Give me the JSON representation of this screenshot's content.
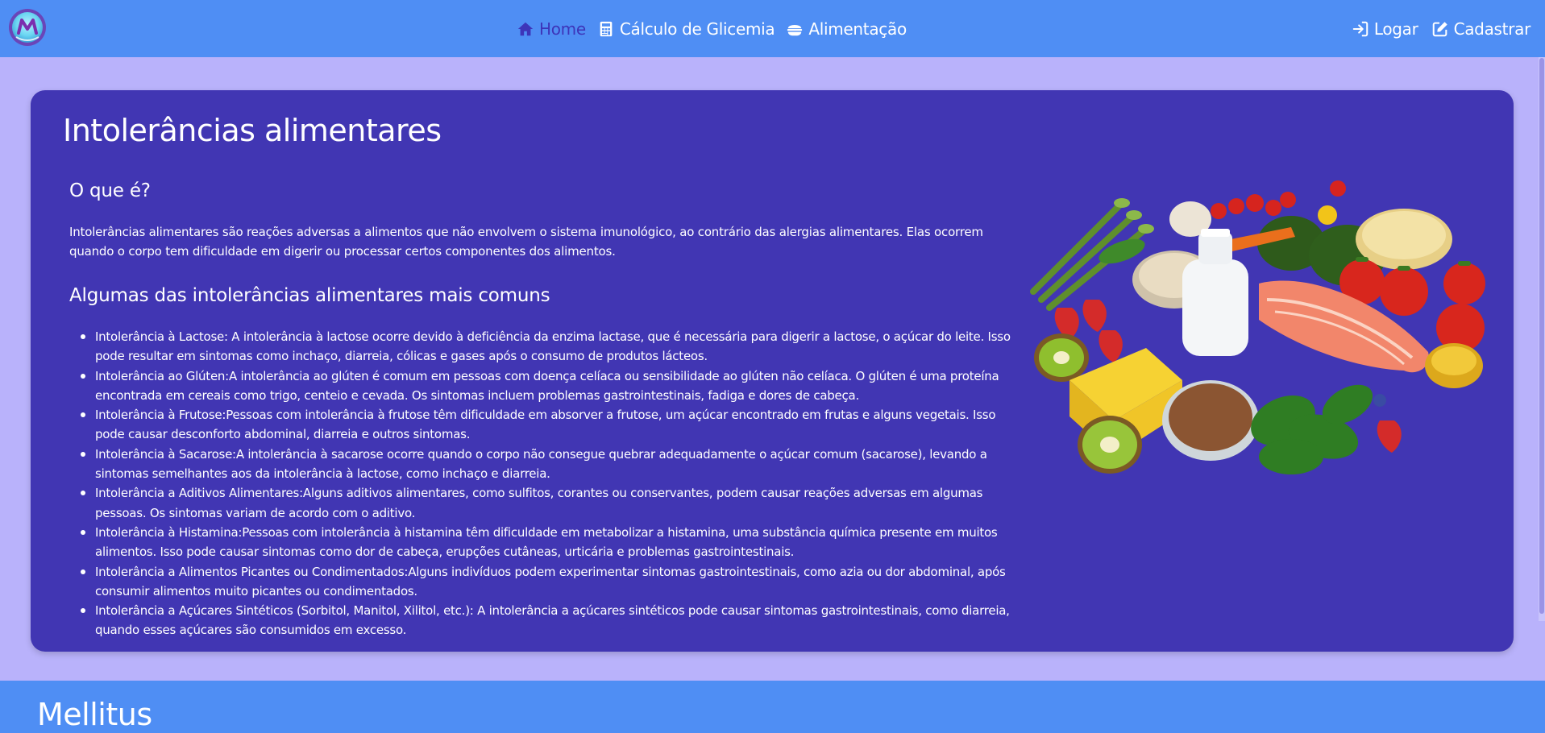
{
  "nav": {
    "logo_alt": "M",
    "links": [
      {
        "label": "Home",
        "icon": "home-icon",
        "active": true
      },
      {
        "label": "Cálculo de Glicemia",
        "icon": "calculator-icon",
        "active": false
      },
      {
        "label": "Alimentação",
        "icon": "food-bowl-icon",
        "active": false
      }
    ],
    "auth": [
      {
        "label": "Logar",
        "icon": "login-icon"
      },
      {
        "label": "Cadastrar",
        "icon": "edit-icon"
      }
    ]
  },
  "card": {
    "title": "Intolerâncias alimentares",
    "what_heading": "O que é?",
    "intro": "Intolerâncias alimentares são reações adversas a alimentos que não envolvem o sistema imunológico, ao contrário das alergias alimentares. Elas ocorrem quando o corpo tem dificuldade em digerir ou processar certos componentes dos alimentos.",
    "common_heading": "Algumas das intolerâncias alimentares mais comuns",
    "items": [
      "Intolerância à Lactose: A intolerância à lactose ocorre devido à deficiência da enzima lactase, que é necessária para digerir a lactose, o açúcar do leite. Isso pode resultar em sintomas como inchaço, diarreia, cólicas e gases após o consumo de produtos lácteos.",
      "Intolerância ao Glúten:A intolerância ao glúten é comum em pessoas com doença celíaca ou sensibilidade ao glúten não celíaca. O glúten é uma proteína encontrada em cereais como trigo, centeio e cevada. Os sintomas incluem problemas gastrointestinais, fadiga e dores de cabeça.",
      "Intolerância à Frutose:Pessoas com intolerância à frutose têm dificuldade em absorver a frutose, um açúcar encontrado em frutas e alguns vegetais. Isso pode causar desconforto abdominal, diarreia e outros sintomas.",
      "Intolerância à Sacarose:A intolerância à sacarose ocorre quando o corpo não consegue quebrar adequadamente o açúcar comum (sacarose), levando a sintomas semelhantes aos da intolerância à lactose, como inchaço e diarreia.",
      "Intolerância a Aditivos Alimentares:Alguns aditivos alimentares, como sulfitos, corantes ou conservantes, podem causar reações adversas em algumas pessoas. Os sintomas variam de acordo com o aditivo.",
      "Intolerância à Histamina:Pessoas com intolerância à histamina têm dificuldade em metabolizar a histamina, uma substância química presente em muitos alimentos. Isso pode causar sintomas como dor de cabeça, erupções cutâneas, urticária e problemas gastrointestinais.",
      "Intolerância a Alimentos Picantes ou Condimentados:Alguns indivíduos podem experimentar sintomas gastrointestinais, como azia ou dor abdominal, após consumir alimentos muito picantes ou condimentados.",
      "Intolerância a Açúcares Sintéticos (Sorbitol, Manitol, Xilitol, etc.): A intolerância a açúcares sintéticos pode causar sintomas gastrointestinais, como diarreia, quando esses açúcares são consumidos em excesso."
    ]
  },
  "footer": {
    "title": "Mellitus"
  },
  "colors": {
    "navbar": "#4f8ef4",
    "page_bg": "#b9b2fb",
    "card_bg": "#4136b3",
    "active_link": "#3d35b9"
  }
}
